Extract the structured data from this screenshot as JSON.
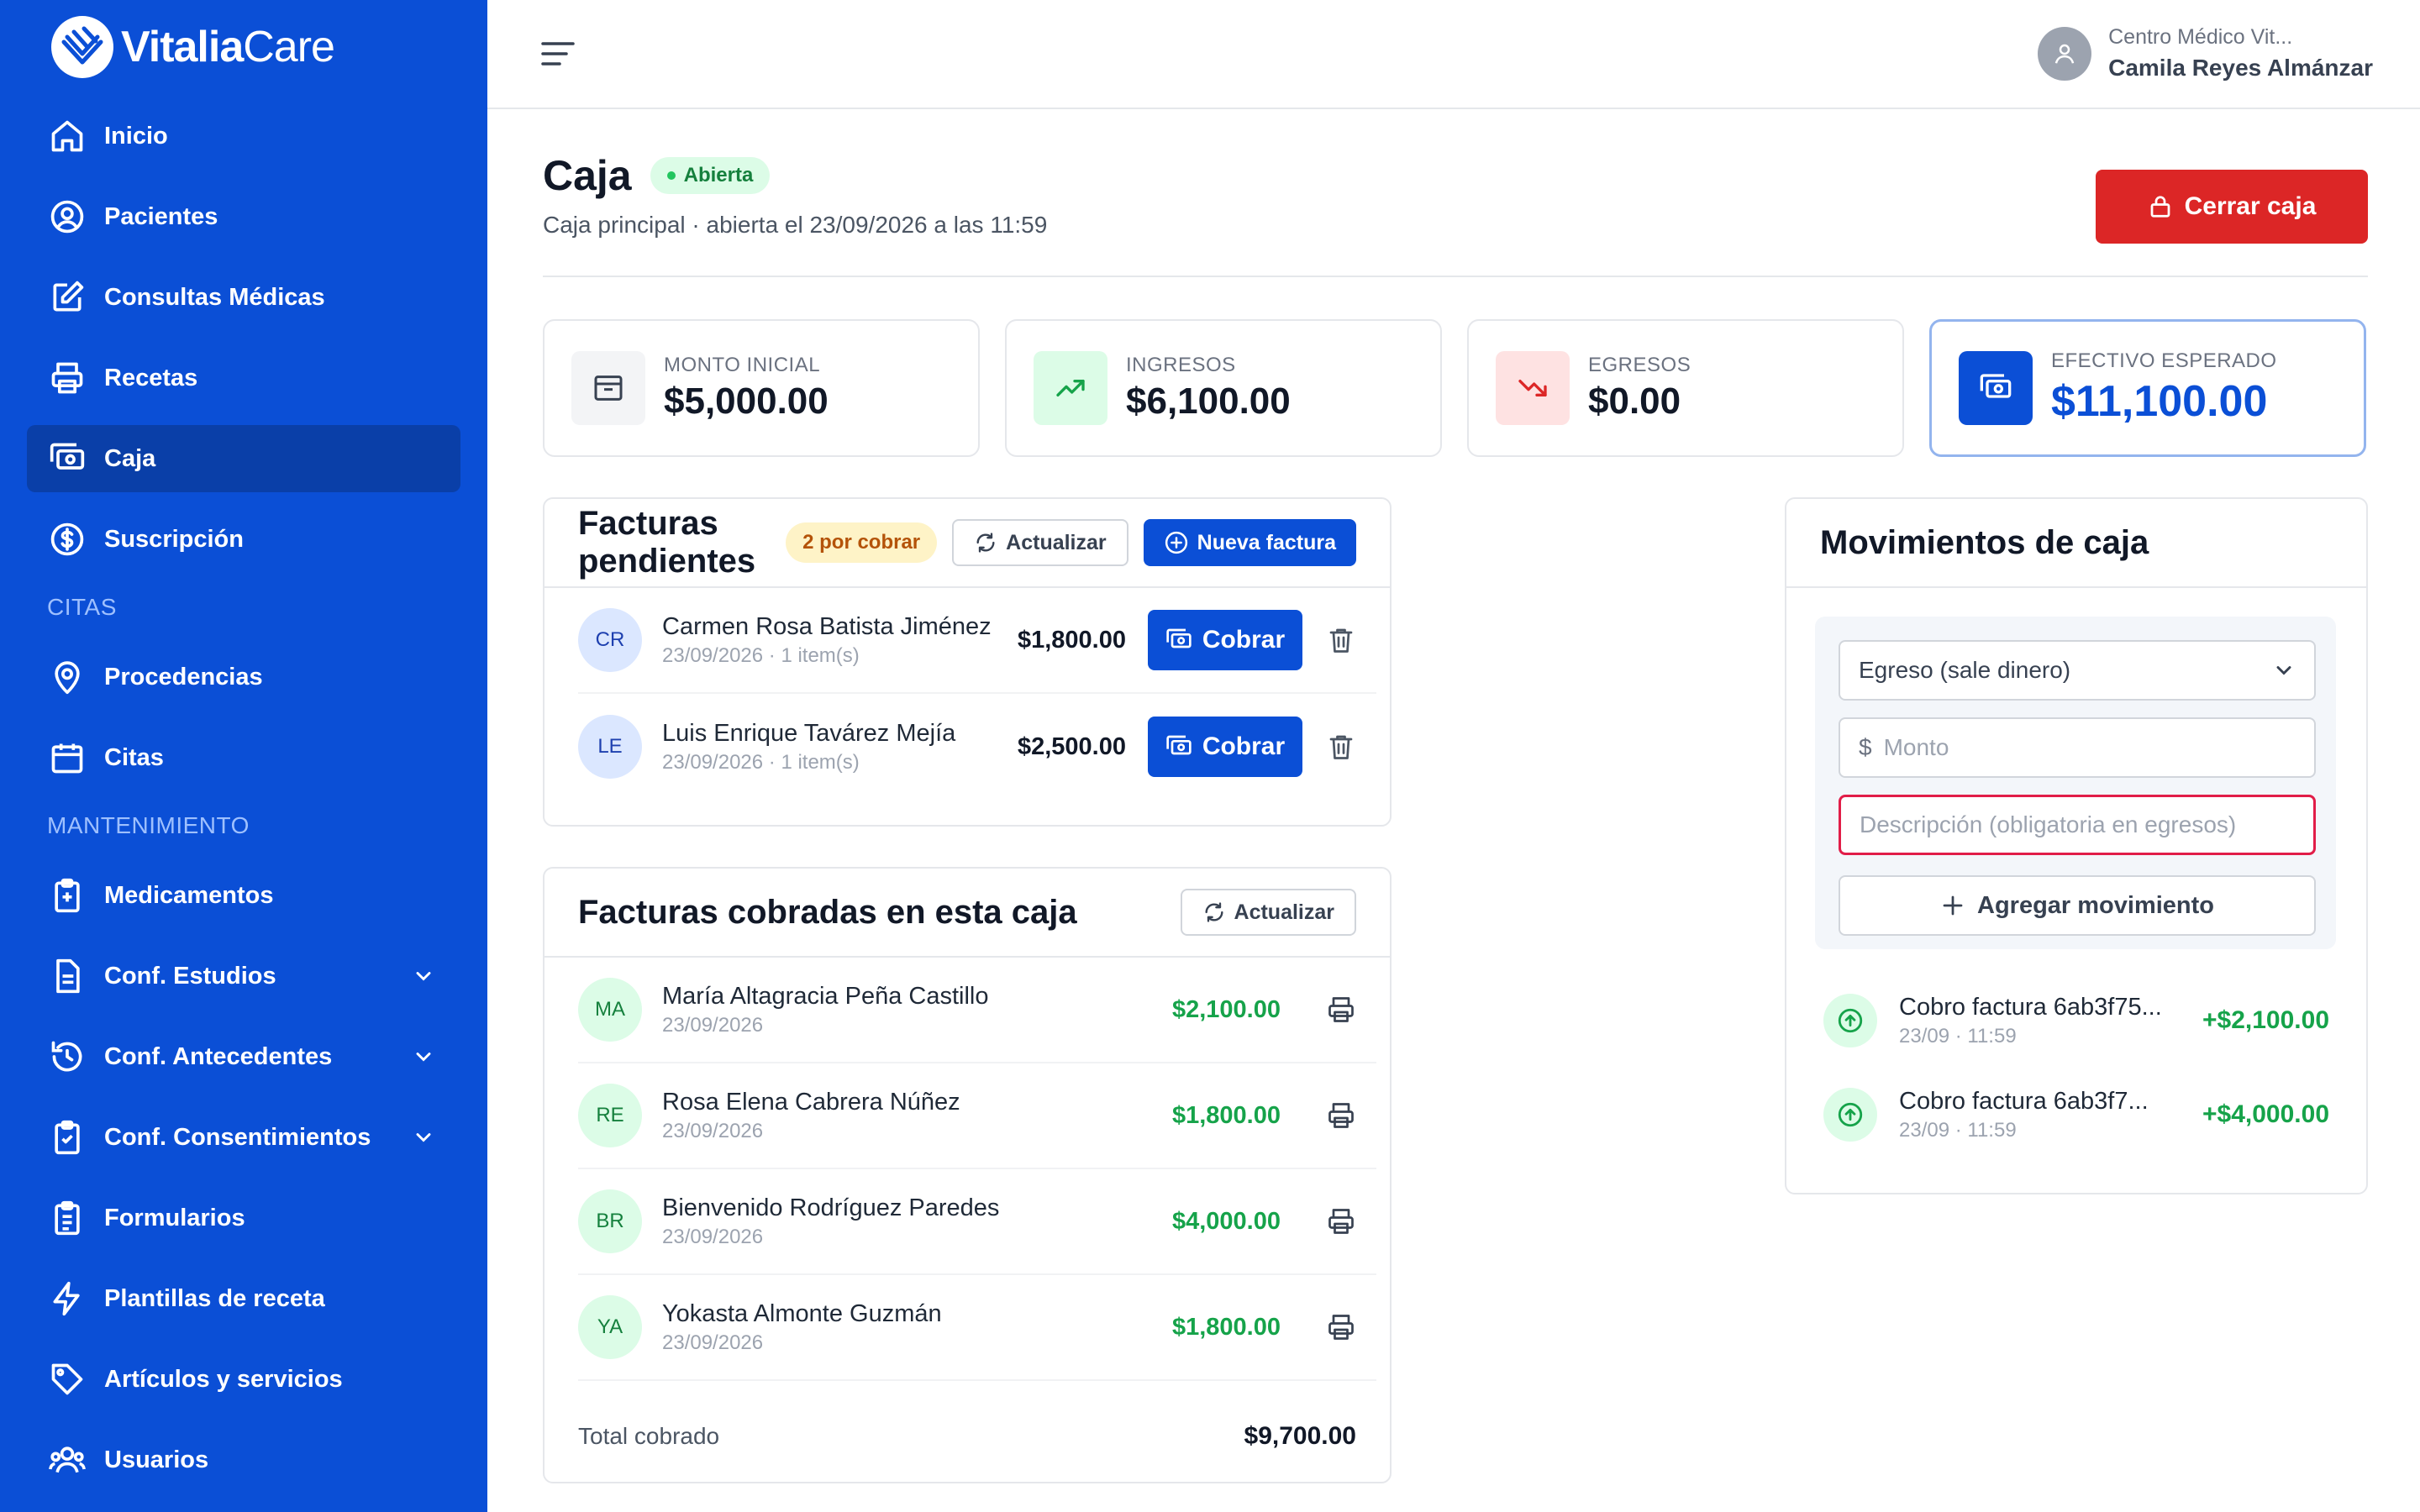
{
  "brand": {
    "name_bold": "Vitalia",
    "name_light": "Care"
  },
  "sidebar": {
    "items": [
      {
        "label": "Inicio"
      },
      {
        "label": "Pacientes"
      },
      {
        "label": "Consultas Médicas"
      },
      {
        "label": "Recetas"
      },
      {
        "label": "Caja"
      },
      {
        "label": "Suscripción"
      }
    ],
    "section_citas": "CITAS",
    "citas_items": [
      {
        "label": "Procedencias"
      },
      {
        "label": "Citas"
      }
    ],
    "section_mant": "MANTENIMIENTO",
    "mant_items": [
      {
        "label": "Medicamentos"
      },
      {
        "label": "Conf. Estudios"
      },
      {
        "label": "Conf. Antecedentes"
      },
      {
        "label": "Conf. Consentimientos"
      },
      {
        "label": "Formularios"
      },
      {
        "label": "Plantillas de receta"
      },
      {
        "label": "Artículos y servicios"
      },
      {
        "label": "Usuarios"
      }
    ]
  },
  "user": {
    "org": "Centro Médico Vit...",
    "name": "Camila Reyes Almánzar"
  },
  "page": {
    "title": "Caja",
    "status": "Abierta",
    "subtitle": "Caja principal · abierta el 23/09/2026 a las 11:59",
    "close_label": "Cerrar caja"
  },
  "stats": {
    "initial": {
      "label": "MONTO INICIAL",
      "value": "$5,000.00"
    },
    "income": {
      "label": "INGRESOS",
      "value": "$6,100.00"
    },
    "expense": {
      "label": "EGRESOS",
      "value": "$0.00"
    },
    "expected": {
      "label": "EFECTIVO ESPERADO",
      "value": "$11,100.00"
    }
  },
  "pending": {
    "title": "Facturas pendientes",
    "badge": "2 por cobrar",
    "refresh_label": "Actualizar",
    "new_label": "Nueva factura",
    "pay_label": "Cobrar",
    "rows": [
      {
        "initials": "CR",
        "name": "Carmen Rosa Batista Jiménez",
        "sub": "23/09/2026 · 1 item(s)",
        "amount": "$1,800.00"
      },
      {
        "initials": "LE",
        "name": "Luis Enrique Tavárez Mejía",
        "sub": "23/09/2026 · 1 item(s)",
        "amount": "$2,500.00"
      }
    ]
  },
  "paid": {
    "title": "Facturas cobradas en esta caja",
    "refresh_label": "Actualizar",
    "rows": [
      {
        "initials": "MA",
        "name": "María Altagracia Peña Castillo",
        "sub": "23/09/2026",
        "amount": "$2,100.00"
      },
      {
        "initials": "RE",
        "name": "Rosa Elena Cabrera Núñez",
        "sub": "23/09/2026",
        "amount": "$1,800.00"
      },
      {
        "initials": "BR",
        "name": "Bienvenido Rodríguez Paredes",
        "sub": "23/09/2026",
        "amount": "$4,000.00"
      },
      {
        "initials": "YA",
        "name": "Yokasta Almonte Guzmán",
        "sub": "23/09/2026",
        "amount": "$1,800.00"
      }
    ],
    "total_label": "Total cobrado",
    "total_value": "$9,700.00"
  },
  "movements": {
    "title": "Movimientos de caja",
    "type_selected": "Egreso (sale dinero)",
    "currency": "$",
    "amount_placeholder": "Monto",
    "desc_placeholder": "Descripción (obligatoria en egresos)",
    "add_label": "Agregar movimiento",
    "items": [
      {
        "title": "Cobro factura 6ab3f75...",
        "sub": "23/09 · 11:59",
        "amount": "+$2,100.00"
      },
      {
        "title": "Cobro factura 6ab3f7...",
        "sub": "23/09 · 11:59",
        "amount": "+$4,000.00"
      }
    ]
  },
  "colors": {
    "sidebar": "#0b4fd6",
    "sidebar_active": "#0a3fa8",
    "primary": "#0b4fd6",
    "danger": "#dc2626",
    "success": "#16a34a"
  }
}
